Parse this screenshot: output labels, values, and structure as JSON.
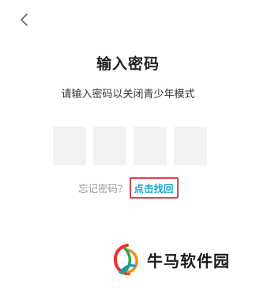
{
  "header": {
    "back_icon": "chevron-left-icon"
  },
  "title": "输入密码",
  "subtitle": "请输入密码以关闭青少年模式",
  "code_boxes": [
    "",
    "",
    "",
    ""
  ],
  "forgot": {
    "text": "忘记密码？",
    "link": "点击找回",
    "link_color": "#1aa6c8",
    "highlight_color": "#e0414a"
  },
  "watermark": {
    "text": "牛马软件园",
    "logo_icon": "niuma-logo-icon"
  }
}
